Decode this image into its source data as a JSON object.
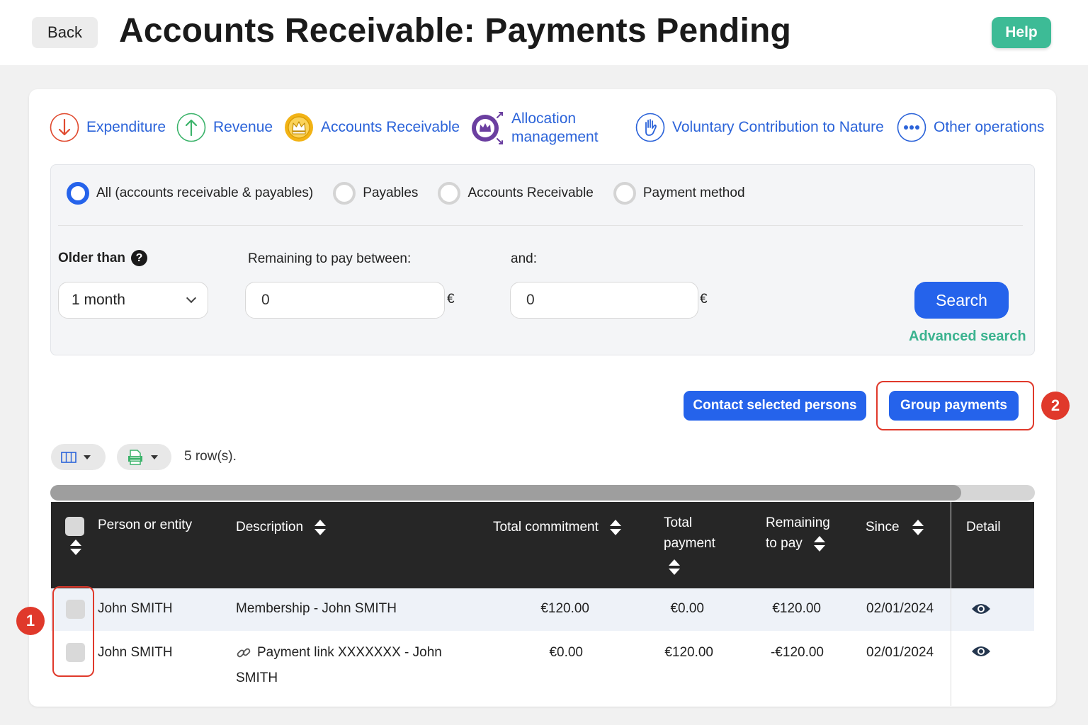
{
  "header": {
    "back_label": "Back",
    "title": "Accounts Receivable: Payments Pending",
    "help_label": "Help"
  },
  "nav": [
    {
      "label": "Expenditure",
      "icon": "arrow-down-icon",
      "color": "#e04a2f"
    },
    {
      "label": "Revenue",
      "icon": "arrow-up-icon",
      "color": "#3bb36a"
    },
    {
      "label": "Accounts Receivable",
      "icon": "crown-icon",
      "color": "#f2b315"
    },
    {
      "label": "Allocation management",
      "icon": "allocation-icon",
      "color": "#6b3fa0"
    },
    {
      "label": "Voluntary Contribution to Nature",
      "icon": "hand-icon",
      "color": "#2b63d9"
    },
    {
      "label": "Other operations",
      "icon": "more-dots-icon",
      "color": "#2b63d9"
    }
  ],
  "filters": {
    "radios": [
      {
        "label": "All (accounts receivable & payables)",
        "selected": true
      },
      {
        "label": "Payables",
        "selected": false
      },
      {
        "label": "Accounts Receivable",
        "selected": false
      },
      {
        "label": "Payment method",
        "selected": false
      }
    ],
    "older_than_label": "Older than",
    "older_than_value": "1 month",
    "remaining_label": "Remaining to pay between:",
    "remaining_min": "0",
    "and_label": "and:",
    "remaining_max": "0",
    "currency": "€",
    "search_label": "Search",
    "advanced_label": "Advanced search"
  },
  "actions": {
    "contact_label": "Contact selected persons",
    "group_label": "Group payments"
  },
  "callouts": {
    "first": "1",
    "second": "2"
  },
  "toolbar": {
    "row_count": "5 row(s)."
  },
  "table": {
    "columns": {
      "person": "Person or entity",
      "description": "Description",
      "total_commitment": "Total commitment",
      "total_payment_1": "Total",
      "total_payment_2": "payment",
      "remaining_1": "Remaining",
      "remaining_2": "to pay",
      "since": "Since",
      "detail": "Detail"
    },
    "rows": [
      {
        "person": "John SMITH",
        "description": "Membership - John SMITH",
        "description_2": "",
        "total_commitment": "€120.00",
        "total_payment": "€0.00",
        "remaining": "€120.00",
        "since": "02/01/2024"
      },
      {
        "person": "John SMITH",
        "description": "Payment link XXXXXXX - John",
        "description_2": "SMITH",
        "total_commitment": "€0.00",
        "total_payment": "€120.00",
        "remaining": "-€120.00",
        "since": "02/01/2024"
      }
    ]
  },
  "colors": {
    "accent": "#2563eb",
    "help": "#3dbb96",
    "advanced": "#3bb38f",
    "highlight": "#e0392b",
    "table_header": "#262626"
  }
}
